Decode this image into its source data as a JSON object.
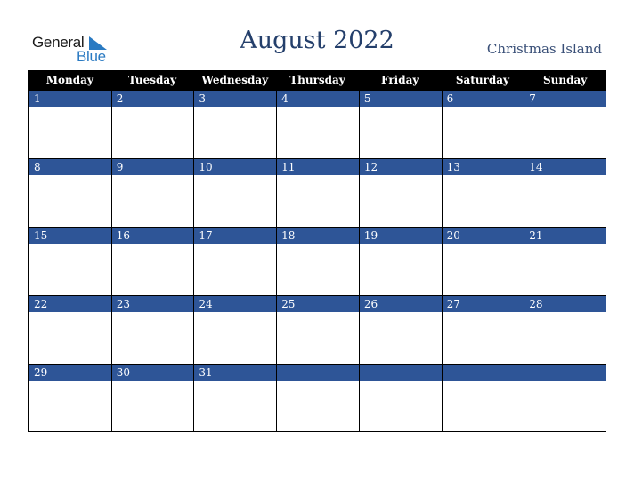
{
  "logo": {
    "line1": "General",
    "line2": "Blue"
  },
  "title": "August 2022",
  "region": "Christmas Island",
  "colors": {
    "header_bg": "#000000",
    "date_bar": "#2e5597",
    "title": "#243f6b",
    "logo_blue": "#2a7ac2"
  },
  "weekdays": [
    "Monday",
    "Tuesday",
    "Wednesday",
    "Thursday",
    "Friday",
    "Saturday",
    "Sunday"
  ],
  "weeks": [
    [
      "1",
      "2",
      "3",
      "4",
      "5",
      "6",
      "7"
    ],
    [
      "8",
      "9",
      "10",
      "11",
      "12",
      "13",
      "14"
    ],
    [
      "15",
      "16",
      "17",
      "18",
      "19",
      "20",
      "21"
    ],
    [
      "22",
      "23",
      "24",
      "25",
      "26",
      "27",
      "28"
    ],
    [
      "29",
      "30",
      "31",
      "",
      "",
      "",
      ""
    ]
  ]
}
